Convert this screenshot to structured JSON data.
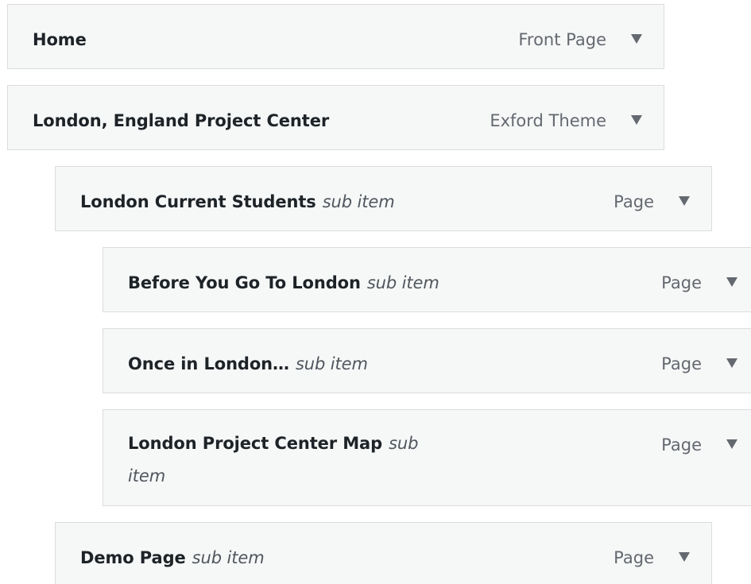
{
  "menu": {
    "items": [
      {
        "title": "Home",
        "sub_label": "",
        "type": "Front Page"
      },
      {
        "title": "London, England Project Center",
        "sub_label": "",
        "type": "Exford Theme"
      },
      {
        "title": "London Current Students",
        "sub_label": "sub item",
        "type": "Page"
      },
      {
        "title": "Before You Go To London",
        "sub_label": "sub item",
        "type": "Page"
      },
      {
        "title": "Once in London…",
        "sub_label": "sub item",
        "type": "Page"
      },
      {
        "title": "London Project Center Map",
        "sub_label": "sub item",
        "type": "Page"
      },
      {
        "title": "Demo Page",
        "sub_label": "sub item",
        "type": "Page"
      }
    ]
  },
  "icons": {
    "toggle": "triangle-down-icon"
  },
  "colors": {
    "item_background": "#f6f7f7",
    "item_border": "#dcdcde",
    "title_text": "#1d2327",
    "secondary_text": "#646970"
  }
}
